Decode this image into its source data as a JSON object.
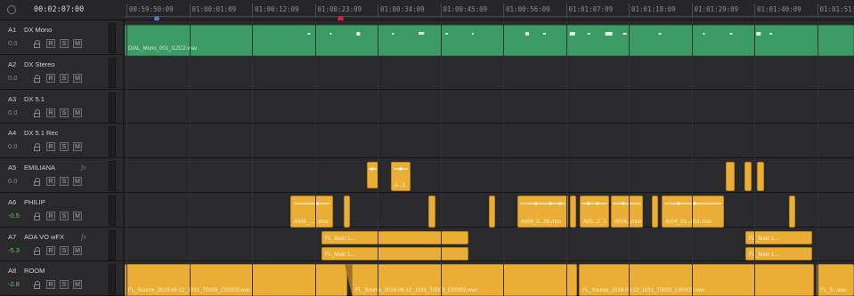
{
  "timecode": "00:02:07:00",
  "ruler": {
    "labels": [
      "00:59:50:09",
      "01:00:01:09",
      "01:00:12:09",
      "01:00:23:09",
      "01:00:34:09",
      "01:00:45:09",
      "01:00:56:09",
      "01:01:07:09",
      "01:01:18:09",
      "01:01:29:09",
      "01:01:40:09",
      "01:01:51:0"
    ]
  },
  "tracks": [
    {
      "id": "A1",
      "name": "DX Mono",
      "fx": "",
      "volume": "0.0",
      "buttons": [
        "R",
        "S",
        "M"
      ]
    },
    {
      "id": "A2",
      "name": "DX Stereo",
      "fx": "",
      "volume": "0.0",
      "buttons": [
        "R",
        "S",
        "M"
      ]
    },
    {
      "id": "A3",
      "name": "DX 5.1",
      "fx": "",
      "volume": "0.0",
      "buttons": [
        "R",
        "S",
        "M"
      ]
    },
    {
      "id": "A4",
      "name": "DX 5.1 Rec",
      "fx": "",
      "volume": "0.0",
      "buttons": [
        "R",
        "S",
        "M"
      ]
    },
    {
      "id": "A5",
      "name": "EMILIANA",
      "fx": "fx",
      "volume": "0.0",
      "buttons": [
        "R",
        "S",
        "M"
      ]
    },
    {
      "id": "A6",
      "name": "PHILIP",
      "fx": "",
      "volume": "-0.5",
      "buttons": [
        "R",
        "S",
        "M"
      ]
    },
    {
      "id": "A7",
      "name": "ADA VO wFX",
      "fx": "fx",
      "volume": "-5.3",
      "buttons": [
        "R",
        "S",
        "M"
      ]
    },
    {
      "id": "A8",
      "name": "ROOM",
      "fx": "",
      "volume": "-2.8",
      "buttons": [
        "R",
        "S",
        "M"
      ]
    }
  ],
  "clips": {
    "a1_main": "DIAL_Mono_001_I1ZC2.wav",
    "a5_small": "A...1",
    "a6_1": "A004_...7.mov",
    "a6_2": "A004_0...05.mov",
    "a6_3": "A00...2_1",
    "a6_4": "A004...mov",
    "a6_5": "A004_01...001.mov",
    "a7_1": "FL_Main 1...",
    "a7_2": "FL_Main 1...",
    "a7_3": "FL_Main 1...",
    "a7_4": "FL_Main 1...",
    "a8_1": "FL_Source_2018-06-12_1031_T0003_C00003.wav",
    "a8_2": "FL_Source_2018-06-12_1031_T0003_C00003.wav",
    "a8_3": "FL_Source_2018-06-12_1031_T0003_C00003.wav",
    "a8_4": "FL_S...wav"
  },
  "colors": {
    "dialogue_clip": "#3c9a64",
    "audio_clip": "#e9ae33",
    "playhead": "#d6213a",
    "in_marker": "#4a7ad1"
  }
}
